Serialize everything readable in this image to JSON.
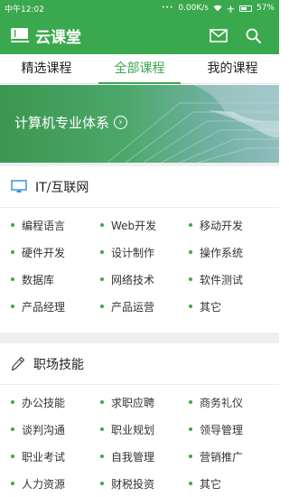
{
  "status": {
    "time": "中午12:02",
    "network": "0.00K/s",
    "battery": "57%"
  },
  "header": {
    "app_name": "云课堂"
  },
  "tabs": [
    {
      "label": "精选课程"
    },
    {
      "label": "全部课程"
    },
    {
      "label": "我的课程"
    }
  ],
  "banner": {
    "text": "计算机专业体系"
  },
  "sections": [
    {
      "title": "IT/互联网",
      "items": [
        "编程语言",
        "Web开发",
        "移动开发",
        "硬件开发",
        "设计制作",
        "操作系统",
        "数据库",
        "网络技术",
        "软件测试",
        "产品经理",
        "产品运营",
        "其它"
      ]
    },
    {
      "title": "职场技能",
      "items": [
        "办公技能",
        "求职应聘",
        "商务礼仪",
        "谈判沟通",
        "职业规划",
        "领导管理",
        "职业考试",
        "自我管理",
        "营销推广",
        "人力资源",
        "财税投资",
        "其它"
      ]
    }
  ],
  "colors": {
    "accent": "#3aa84c"
  }
}
